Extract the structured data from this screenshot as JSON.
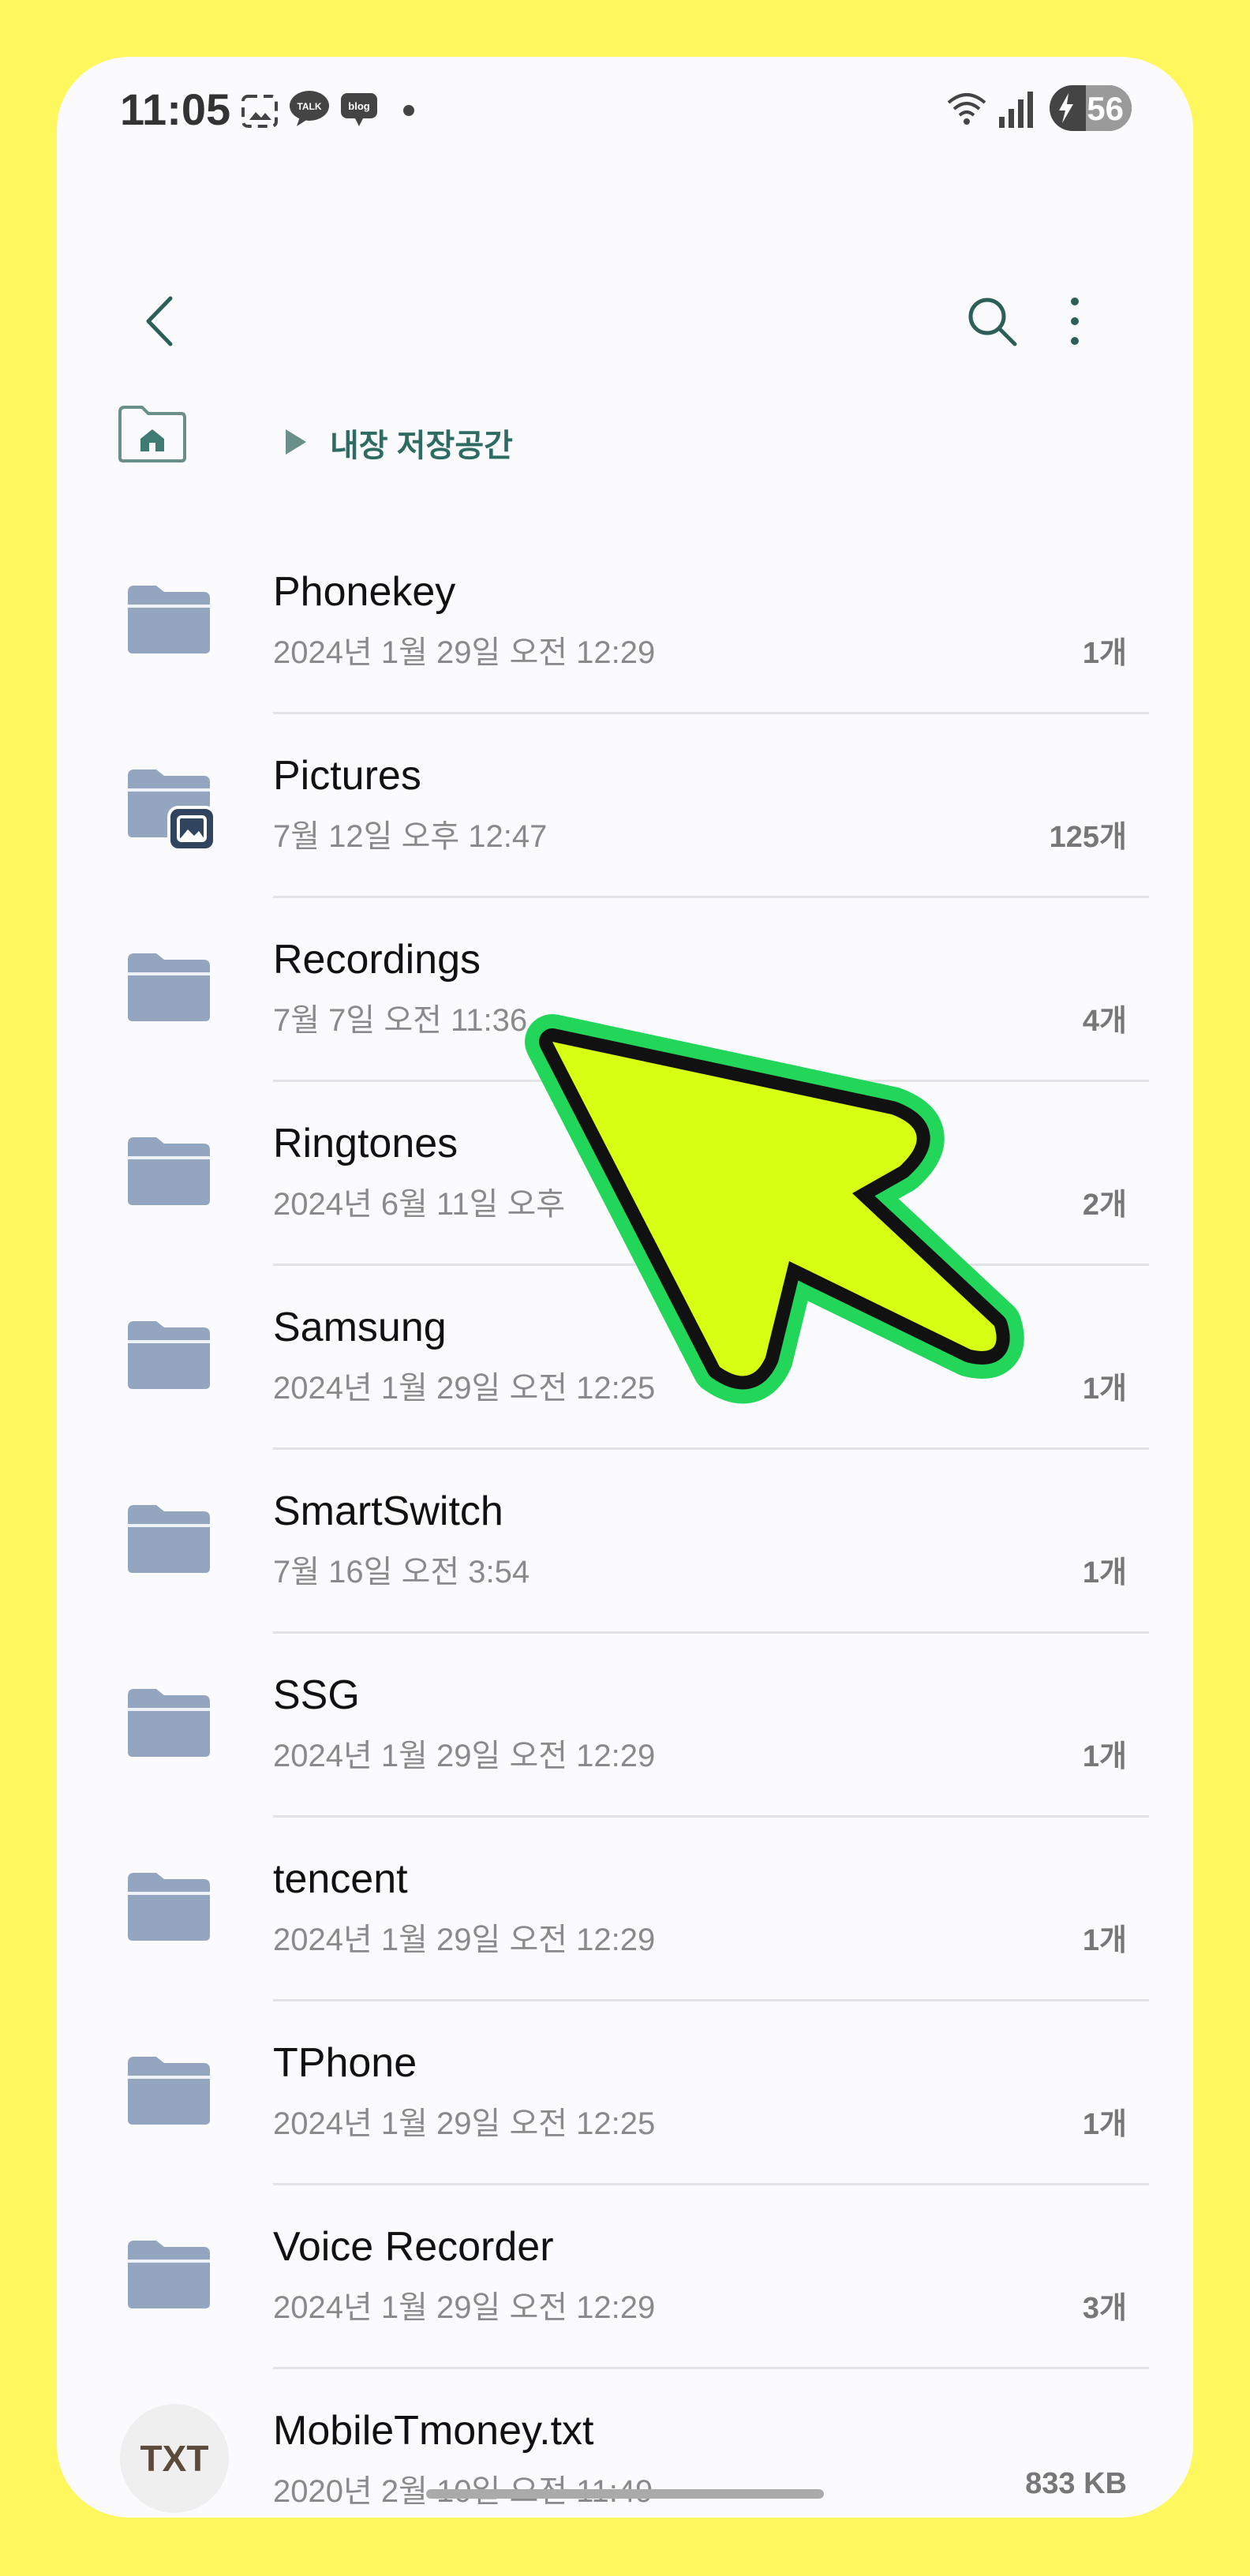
{
  "status": {
    "time": "11:05",
    "battery": "56",
    "notification_icons": [
      "screenshot-icon",
      "kakaotalk-icon",
      "blog-icon",
      "dot-icon"
    ],
    "system_icons": [
      "wifi-6-icon",
      "signal-icon",
      "battery-icon"
    ],
    "talk_label": "TALK",
    "blog_label": "blog"
  },
  "toolbar": {
    "back_icon": "back-chevron-icon",
    "search_icon": "search-icon",
    "more_icon": "more-vertical-icon"
  },
  "breadcrumb": {
    "home_icon": "home-folder-icon",
    "current": "내장 저장공간"
  },
  "files": [
    {
      "name": "Phonekey",
      "date": "2024년 1월 29일 오전 12:29",
      "count": "1개",
      "icon": "folder-icon"
    },
    {
      "name": "Pictures",
      "date": "7월 12일 오후 12:47",
      "count": "125개",
      "icon": "folder-pictures-icon"
    },
    {
      "name": "Recordings",
      "date": "7월 7일 오전 11:36",
      "count": "4개",
      "icon": "folder-icon"
    },
    {
      "name": "Ringtones",
      "date": "2024년 6월 11일 오후",
      "count": "2개",
      "icon": "folder-icon"
    },
    {
      "name": "Samsung",
      "date": "2024년 1월 29일 오전 12:25",
      "count": "1개",
      "icon": "folder-icon"
    },
    {
      "name": "SmartSwitch",
      "date": "7월 16일 오전 3:54",
      "count": "1개",
      "icon": "folder-icon"
    },
    {
      "name": "SSG",
      "date": "2024년 1월 29일 오전 12:29",
      "count": "1개",
      "icon": "folder-icon"
    },
    {
      "name": "tencent",
      "date": "2024년 1월 29일 오전 12:29",
      "count": "1개",
      "icon": "folder-icon"
    },
    {
      "name": "TPhone",
      "date": "2024년 1월 29일 오전 12:25",
      "count": "1개",
      "icon": "folder-icon"
    },
    {
      "name": "Voice Recorder",
      "date": "2024년 1월 29일 오전 12:29",
      "count": "3개",
      "icon": "folder-icon"
    },
    {
      "name": "MobileTmoney.txt",
      "date": "2020년 2월 10일 오전 11:49",
      "count": "833 KB",
      "icon": "txt-file-icon",
      "badge": "TXT"
    }
  ],
  "colors": {
    "background": "#fff75e",
    "folder": "#94a6bf",
    "accent": "#2d6b63",
    "cursor_fill": "#d6ff14",
    "cursor_outline": "#22d65a"
  },
  "overlay": {
    "icon": "pointer-arrow-icon"
  }
}
